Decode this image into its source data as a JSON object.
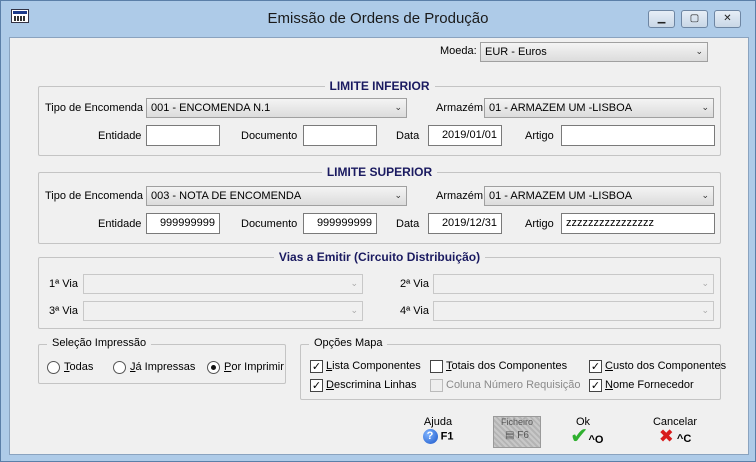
{
  "window": {
    "title": "Emissão de Ordens de Produção"
  },
  "moeda": {
    "label": "Moeda:",
    "value": "EUR - Euros"
  },
  "limite_inferior": {
    "title": "LIMITE INFERIOR",
    "tipo_label": "Tipo de Encomenda",
    "tipo_value": "001 - ENCOMENDA N.1",
    "armazem_label": "Armazém",
    "armazem_value": "01 - ARMAZEM UM -LISBOA",
    "entidade_label": "Entidade",
    "entidade_value": "",
    "documento_label": "Documento",
    "documento_value": "",
    "data_label": "Data",
    "data_value": "2019/01/01",
    "artigo_label": "Artigo",
    "artigo_value": ""
  },
  "limite_superior": {
    "title": "LIMITE SUPERIOR",
    "tipo_label": "Tipo de Encomenda",
    "tipo_value": "003 - NOTA DE ENCOMENDA",
    "armazem_label": "Armazém",
    "armazem_value": "01 - ARMAZEM UM -LISBOA",
    "entidade_label": "Entidade",
    "entidade_value": "999999999",
    "documento_label": "Documento",
    "documento_value": "999999999",
    "data_label": "Data",
    "data_value": "2019/12/31",
    "artigo_label": "Artigo",
    "artigo_value": "zzzzzzzzzzzzzzzz"
  },
  "vias": {
    "title": "Vias a Emitir (Circuito Distribuição)",
    "via1": "1ª Via",
    "via2": "2ª Via",
    "via3": "3ª Via",
    "via4": "4ª Via"
  },
  "selecao": {
    "title": "Seleção Impressão",
    "todas_u": "T",
    "todas_rest": "odas",
    "ja_u": "J",
    "ja_rest": "á Impressas",
    "por_u": "P",
    "por_rest": "or Imprimir",
    "selected": "Por Imprimir"
  },
  "opcoes": {
    "title": "Opções Mapa",
    "lista_u": "L",
    "lista_rest": "ista Componentes",
    "lista_checked": true,
    "totais_u": "T",
    "totais_rest": "otais dos Componentes",
    "totais_checked": false,
    "custo_u": "C",
    "custo_rest": "usto dos Componentes",
    "custo_checked": true,
    "descrimina_u": "D",
    "descrimina_rest": "escrimina Linhas",
    "descrimina_checked": true,
    "coluna": "Coluna Número Requisição",
    "coluna_checked": false,
    "nome_u": "N",
    "nome_rest": "ome Fornecedor",
    "nome_checked": true
  },
  "toolbar": {
    "ajuda_label": "Ajuda",
    "ajuda_key": "F1",
    "ficheiro_label": "Ficheiro",
    "ficheiro_key": "F6",
    "ok_label": "Ok",
    "ok_key": "^O",
    "cancelar_label": "Cancelar",
    "cancelar_key": "^C"
  },
  "colors": {
    "titlebar": "#aecbe8",
    "group_title": "#1a1a60",
    "ok_check": "#2fb02f",
    "cancel_x": "#d81b1b"
  }
}
